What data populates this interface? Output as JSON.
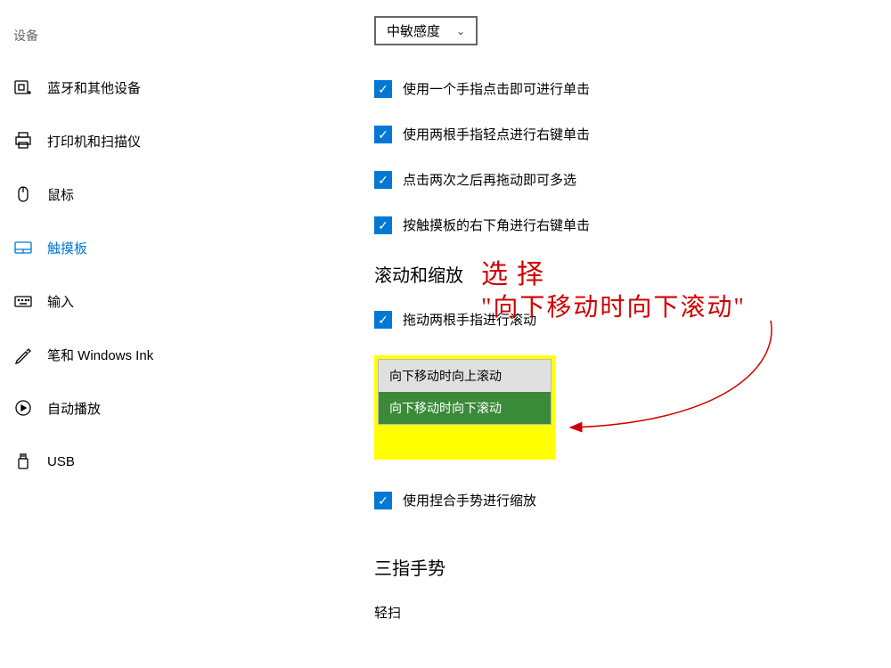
{
  "sidebar": {
    "header": "设备",
    "items": [
      {
        "label": "蓝牙和其他设备"
      },
      {
        "label": "打印机和扫描仪"
      },
      {
        "label": "鼠标"
      },
      {
        "label": "触摸板"
      },
      {
        "label": "输入"
      },
      {
        "label": "笔和 Windows Ink"
      },
      {
        "label": "自动播放"
      },
      {
        "label": "USB"
      }
    ]
  },
  "main": {
    "sensitivity_dropdown": "中敏感度",
    "checkboxes": {
      "tap_single_click": "使用一个手指点击即可进行单击",
      "tap_right_click": "使用两根手指轻点进行右键单击",
      "tap_multiselect": "点击两次之后再拖动即可多选",
      "corner_right_click": "按触摸板的右下角进行右键单击",
      "two_finger_scroll": "拖动两根手指进行滚动",
      "pinch_zoom": "使用捏合手势进行缩放"
    },
    "scroll_section_heading": "滚动和缩放",
    "scroll_options": {
      "opt1": "向下移动时向上滚动",
      "opt2": "向下移动时向下滚动"
    },
    "three_finger_heading": "三指手势",
    "swipe_label": "轻扫"
  },
  "annotation": {
    "line1": "选择",
    "line2": "\"向下移动时向下滚动\""
  }
}
